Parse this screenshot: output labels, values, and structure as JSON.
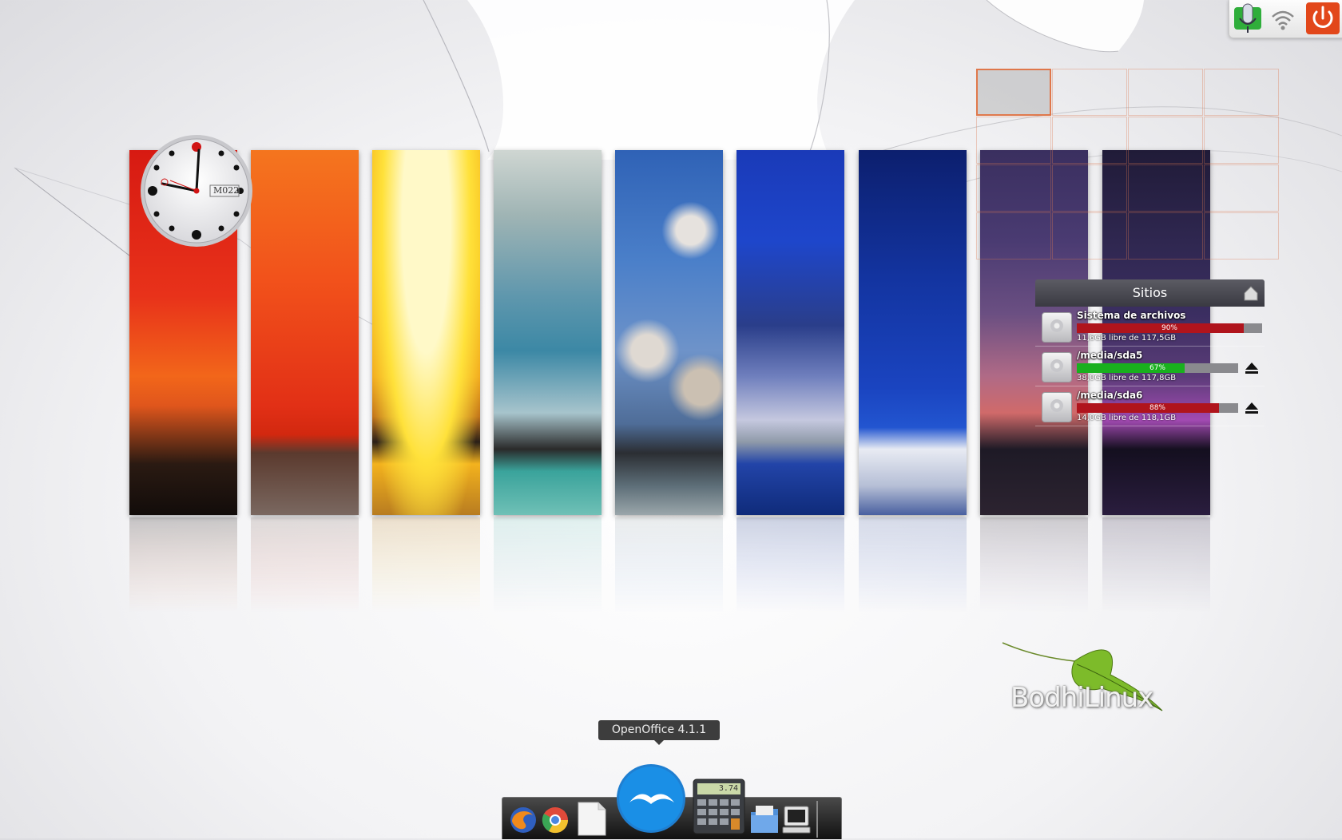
{
  "clock": {
    "brand_text": "M022"
  },
  "pager": {
    "rows": 4,
    "cols": 4,
    "active_index": 0
  },
  "places": {
    "title": "Sitios",
    "drives": [
      {
        "name": "Sistema de archivos",
        "percent_label": "90%",
        "free": "11,6GB libre de 117,5GB",
        "fill_color": "#b0141c",
        "usage": 0.9,
        "ejectable": false
      },
      {
        "name": "/media/sda5",
        "percent_label": "67%",
        "free": "38,0GB libre de 117,8GB",
        "fill_color": "#19b01e",
        "usage": 0.67,
        "ejectable": true
      },
      {
        "name": "/media/sda6",
        "percent_label": "88%",
        "free": "14,0GB libre de 118,1GB",
        "fill_color": "#b0141c",
        "usage": 0.88,
        "ejectable": true
      }
    ]
  },
  "dock": {
    "tooltip": "OpenOffice 4.1.1",
    "items": [
      "firefox-icon",
      "chromium-icon",
      "text-editor-icon",
      "openoffice-icon",
      "calculator-icon",
      "file-manager-icon",
      "terminal-icon"
    ],
    "calculator_display": "3.74"
  },
  "watermark": {
    "text": "BodhiLinux"
  },
  "topbar": {
    "items": [
      "microphone-icon",
      "wifi-icon",
      "power-icon"
    ],
    "power_color": "#e2471a"
  }
}
